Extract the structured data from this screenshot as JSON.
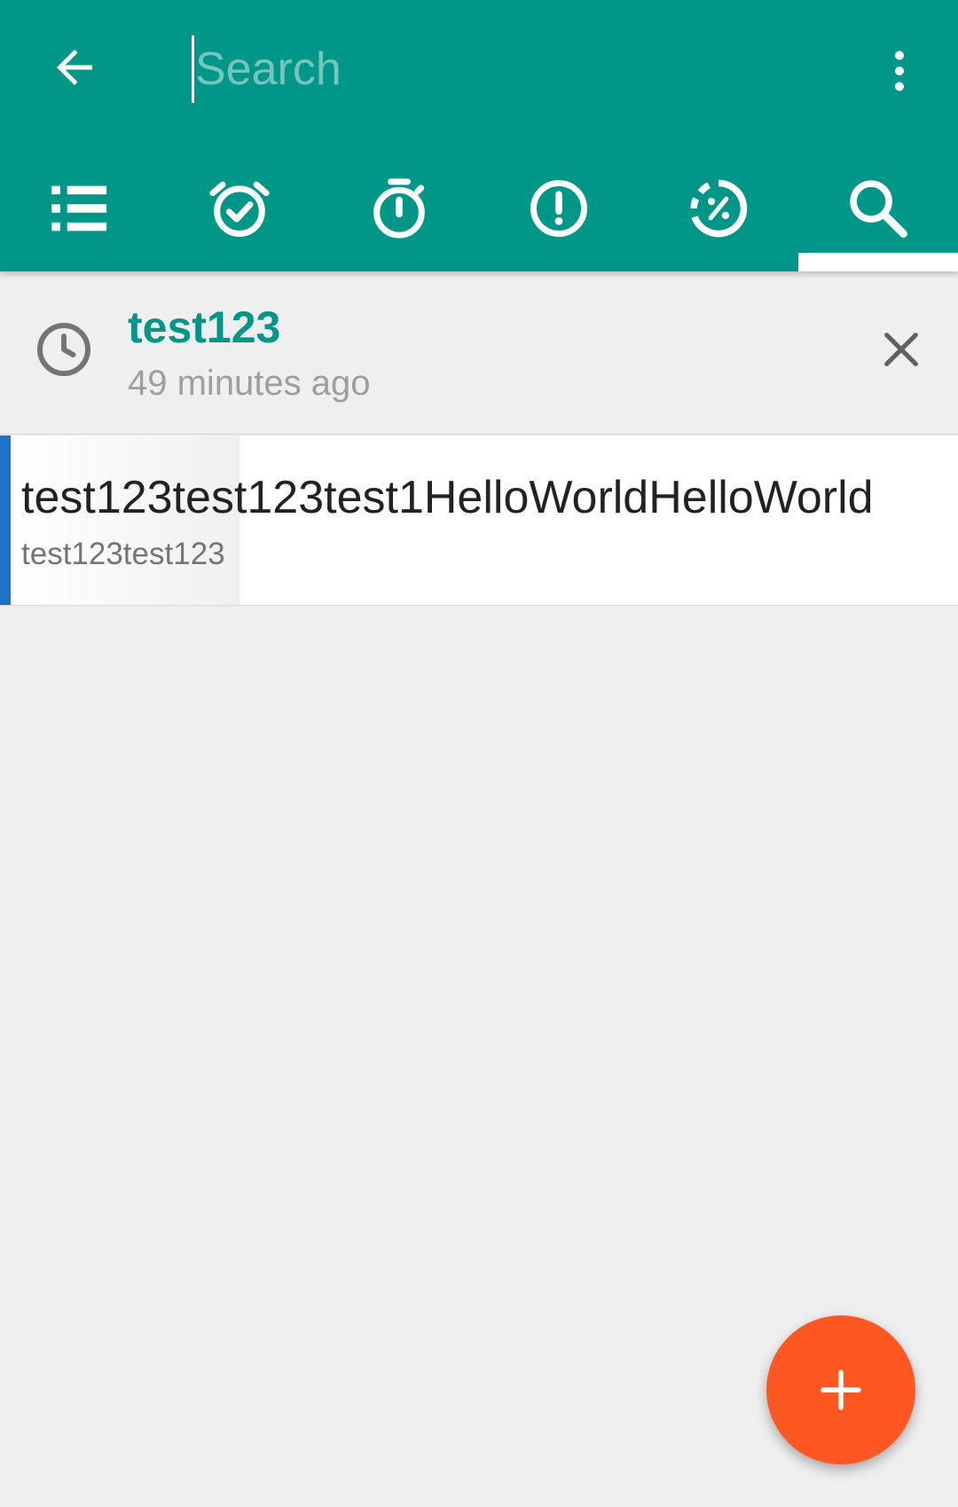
{
  "colors": {
    "primary": "#009688",
    "accent": "#ff5722",
    "result_marker": "#1e73c8"
  },
  "appbar": {
    "back_icon": "arrow-back-icon",
    "search": {
      "value": "",
      "placeholder": "Search"
    },
    "overflow_icon": "more-vert-icon"
  },
  "tabs": [
    {
      "icon": "list-icon",
      "selected": false
    },
    {
      "icon": "alarm-check-icon",
      "selected": false
    },
    {
      "icon": "timer-icon",
      "selected": false
    },
    {
      "icon": "alert-circle-icon",
      "selected": false
    },
    {
      "icon": "progress-percent-icon",
      "selected": false
    },
    {
      "icon": "search-icon",
      "selected": true
    }
  ],
  "history": {
    "query": "test123",
    "time": "49 minutes ago"
  },
  "results": [
    {
      "title": "test123test123test1HelloWorldHelloWorld",
      "subtitle": "test123test123"
    }
  ],
  "fab": {
    "icon": "add-icon"
  }
}
